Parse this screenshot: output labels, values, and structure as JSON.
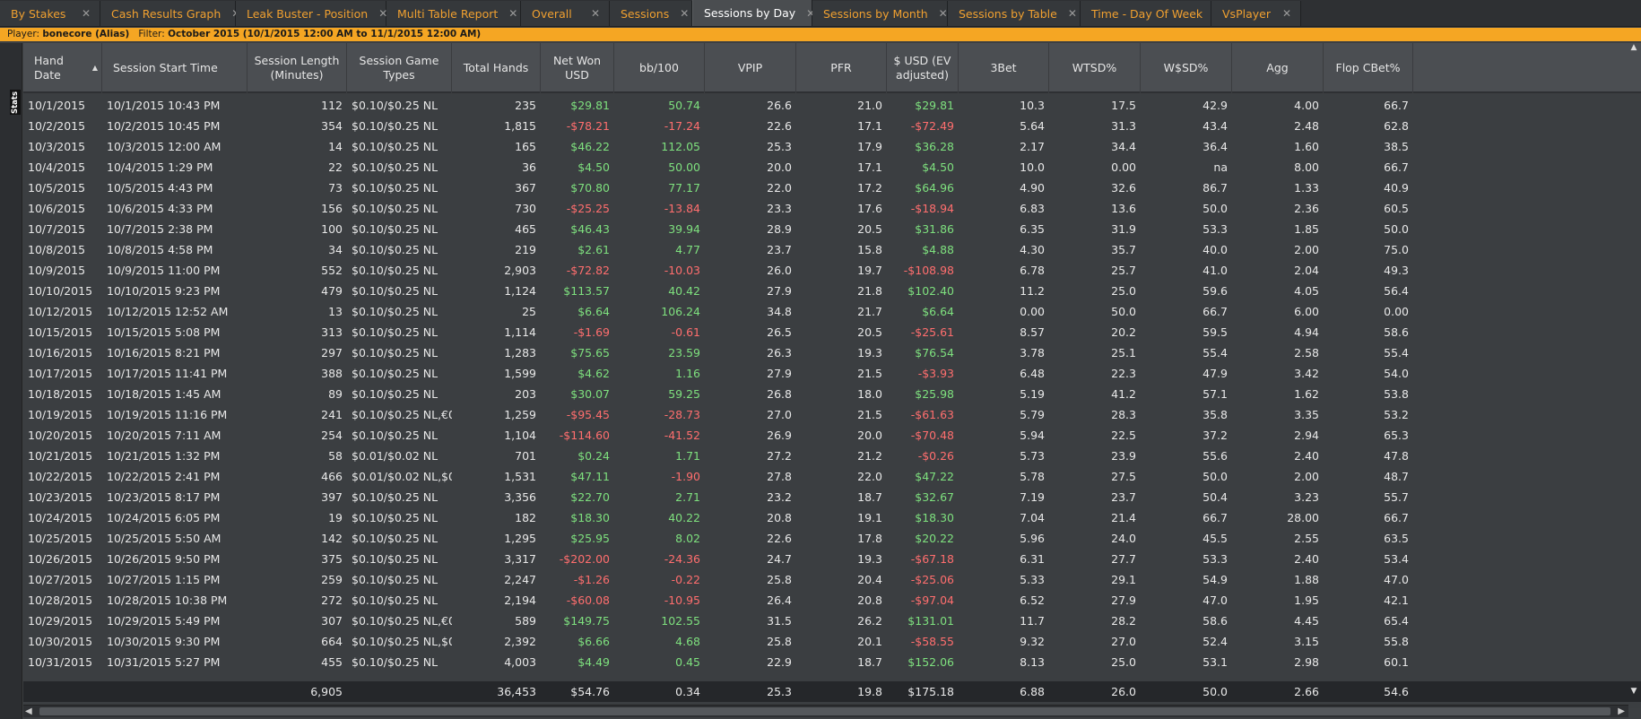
{
  "tabs": [
    {
      "label": "By Stakes",
      "width": 112,
      "active": false
    },
    {
      "label": "Cash Results Graph",
      "width": 151,
      "active": false
    },
    {
      "label": "Leak Buster - Position",
      "width": 168,
      "active": false
    },
    {
      "label": "Multi Table Report",
      "width": 150,
      "active": false
    },
    {
      "label": "Overall",
      "width": 99,
      "active": false
    },
    {
      "label": "Sessions",
      "width": 92,
      "active": false
    },
    {
      "label": "Sessions by Day",
      "width": 134,
      "active": true
    },
    {
      "label": "Sessions by Month",
      "width": 151,
      "active": false
    },
    {
      "label": "Sessions by Table",
      "width": 148,
      "active": false
    },
    {
      "label": "Time - Day Of Week",
      "width": 146,
      "active": false
    },
    {
      "label": "VsPlayer",
      "width": 100,
      "active": false
    }
  ],
  "tab_close_glyph": "✕",
  "filter": {
    "player_label": "Player:",
    "player": "bonecore (Alias)",
    "filter_label": "Filter:",
    "filter": "October 2015 (10/1/2015 12:00 AM to 11/1/2015 12:00 AM)"
  },
  "stats_button": "Stats",
  "sort_indicator": "▲",
  "columns": [
    {
      "label": "Hand Date",
      "align": "l",
      "sorted": true
    },
    {
      "label": "Session Start Time",
      "align": "l"
    },
    {
      "label": "Session Length (Minutes)",
      "align": "r"
    },
    {
      "label": "Session Game Types",
      "align": "l"
    },
    {
      "label": "Total Hands",
      "align": "r"
    },
    {
      "label": "Net Won USD",
      "align": "r",
      "colored": true
    },
    {
      "label": "bb/100",
      "align": "r",
      "colored": true
    },
    {
      "label": "VPIP",
      "align": "r"
    },
    {
      "label": "PFR",
      "align": "r"
    },
    {
      "label": "$ USD (EV adjusted)",
      "align": "r",
      "colored": true
    },
    {
      "label": "3Bet",
      "align": "r"
    },
    {
      "label": "WTSD%",
      "align": "r"
    },
    {
      "label": "W$SD%",
      "align": "r"
    },
    {
      "label": "Agg",
      "align": "r"
    },
    {
      "label": "Flop CBet%",
      "align": "r"
    }
  ],
  "rows": [
    [
      "10/1/2015",
      "10/1/2015 10:43 PM",
      "112",
      "$0.10/$0.25 NL",
      "235",
      "$29.81",
      "50.74",
      "26.6",
      "21.0",
      "$29.81",
      "10.3",
      "17.5",
      "42.9",
      "4.00",
      "66.7"
    ],
    [
      "10/2/2015",
      "10/2/2015 10:45 PM",
      "354",
      "$0.10/$0.25 NL",
      "1,815",
      "-$78.21",
      "-17.24",
      "22.6",
      "17.1",
      "-$72.49",
      "5.64",
      "31.3",
      "43.4",
      "2.48",
      "62.8"
    ],
    [
      "10/3/2015",
      "10/3/2015 12:00 AM",
      "14",
      "$0.10/$0.25 NL",
      "165",
      "$46.22",
      "112.05",
      "25.3",
      "17.9",
      "$36.28",
      "2.17",
      "34.4",
      "36.4",
      "1.60",
      "38.5"
    ],
    [
      "10/4/2015",
      "10/4/2015 1:29 PM",
      "22",
      "$0.10/$0.25 NL",
      "36",
      "$4.50",
      "50.00",
      "20.0",
      "17.1",
      "$4.50",
      "10.0",
      "0.00",
      "na",
      "8.00",
      "66.7"
    ],
    [
      "10/5/2015",
      "10/5/2015 4:43 PM",
      "73",
      "$0.10/$0.25 NL",
      "367",
      "$70.80",
      "77.17",
      "22.0",
      "17.2",
      "$64.96",
      "4.90",
      "32.6",
      "86.7",
      "1.33",
      "40.9"
    ],
    [
      "10/6/2015",
      "10/6/2015 4:33 PM",
      "156",
      "$0.10/$0.25 NL",
      "730",
      "-$25.25",
      "-13.84",
      "23.3",
      "17.6",
      "-$18.94",
      "6.83",
      "13.6",
      "50.0",
      "2.36",
      "60.5"
    ],
    [
      "10/7/2015",
      "10/7/2015 2:38 PM",
      "100",
      "$0.10/$0.25 NL",
      "465",
      "$46.43",
      "39.94",
      "28.9",
      "20.5",
      "$31.86",
      "6.35",
      "31.9",
      "53.3",
      "1.85",
      "50.0"
    ],
    [
      "10/8/2015",
      "10/8/2015 4:58 PM",
      "34",
      "$0.10/$0.25 NL",
      "219",
      "$2.61",
      "4.77",
      "23.7",
      "15.8",
      "$4.88",
      "4.30",
      "35.7",
      "40.0",
      "2.00",
      "75.0"
    ],
    [
      "10/9/2015",
      "10/9/2015 11:00 PM",
      "552",
      "$0.10/$0.25 NL",
      "2,903",
      "-$72.82",
      "-10.03",
      "26.0",
      "19.7",
      "-$108.98",
      "6.78",
      "25.7",
      "41.0",
      "2.04",
      "49.3"
    ],
    [
      "10/10/2015",
      "10/10/2015 9:23 PM",
      "479",
      "$0.10/$0.25 NL",
      "1,124",
      "$113.57",
      "40.42",
      "27.9",
      "21.8",
      "$102.40",
      "11.2",
      "25.0",
      "59.6",
      "4.05",
      "56.4"
    ],
    [
      "10/12/2015",
      "10/12/2015 12:52 AM",
      "13",
      "$0.10/$0.25 NL",
      "25",
      "$6.64",
      "106.24",
      "34.8",
      "21.7",
      "$6.64",
      "0.00",
      "50.0",
      "66.7",
      "6.00",
      "0.00"
    ],
    [
      "10/15/2015",
      "10/15/2015 5:08 PM",
      "313",
      "$0.10/$0.25 NL",
      "1,114",
      "-$1.69",
      "-0.61",
      "26.5",
      "20.5",
      "-$25.61",
      "8.57",
      "20.2",
      "59.5",
      "4.94",
      "58.6"
    ],
    [
      "10/16/2015",
      "10/16/2015 8:21 PM",
      "297",
      "$0.10/$0.25 NL",
      "1,283",
      "$75.65",
      "23.59",
      "26.3",
      "19.3",
      "$76.54",
      "3.78",
      "25.1",
      "55.4",
      "2.58",
      "55.4"
    ],
    [
      "10/17/2015",
      "10/17/2015 11:41 PM",
      "388",
      "$0.10/$0.25 NL",
      "1,599",
      "$4.62",
      "1.16",
      "27.9",
      "21.5",
      "-$3.93",
      "6.48",
      "22.3",
      "47.9",
      "3.42",
      "54.0"
    ],
    [
      "10/18/2015",
      "10/18/2015 1:45 AM",
      "89",
      "$0.10/$0.25 NL",
      "203",
      "$30.07",
      "59.25",
      "26.8",
      "18.0",
      "$25.98",
      "5.19",
      "41.2",
      "57.1",
      "1.62",
      "53.8"
    ],
    [
      "10/19/2015",
      "10/19/2015 11:16 PM",
      "241",
      "$0.10/$0.25 NL,€0.01/€",
      "1,259",
      "-$95.45",
      "-28.73",
      "27.0",
      "21.5",
      "-$61.63",
      "5.79",
      "28.3",
      "35.8",
      "3.35",
      "53.2"
    ],
    [
      "10/20/2015",
      "10/20/2015 7:11 AM",
      "254",
      "$0.10/$0.25 NL",
      "1,104",
      "-$114.60",
      "-41.52",
      "26.9",
      "20.0",
      "-$70.48",
      "5.94",
      "22.5",
      "37.2",
      "2.94",
      "65.3"
    ],
    [
      "10/21/2015",
      "10/21/2015 1:32 PM",
      "58",
      "$0.01/$0.02 NL",
      "701",
      "$0.24",
      "1.71",
      "27.2",
      "21.2",
      "-$0.26",
      "5.73",
      "23.9",
      "55.6",
      "2.40",
      "47.8"
    ],
    [
      "10/22/2015",
      "10/22/2015 2:41 PM",
      "466",
      "$0.01/$0.02 NL,$0.10/$",
      "1,531",
      "$47.11",
      "-1.90",
      "27.8",
      "22.0",
      "$47.22",
      "5.78",
      "27.5",
      "50.0",
      "2.00",
      "48.7"
    ],
    [
      "10/23/2015",
      "10/23/2015 8:17 PM",
      "397",
      "$0.10/$0.25 NL",
      "3,356",
      "$22.70",
      "2.71",
      "23.2",
      "18.7",
      "$32.67",
      "7.19",
      "23.7",
      "50.4",
      "3.23",
      "55.7"
    ],
    [
      "10/24/2015",
      "10/24/2015 6:05 PM",
      "19",
      "$0.10/$0.25 NL",
      "182",
      "$18.30",
      "40.22",
      "20.8",
      "19.1",
      "$18.30",
      "7.04",
      "21.4",
      "66.7",
      "28.00",
      "66.7"
    ],
    [
      "10/25/2015",
      "10/25/2015 5:50 AM",
      "142",
      "$0.10/$0.25 NL",
      "1,295",
      "$25.95",
      "8.02",
      "22.6",
      "17.8",
      "$20.22",
      "5.96",
      "24.0",
      "45.5",
      "2.55",
      "63.5"
    ],
    [
      "10/26/2015",
      "10/26/2015 9:50 PM",
      "375",
      "$0.10/$0.25 NL",
      "3,317",
      "-$202.00",
      "-24.36",
      "24.7",
      "19.3",
      "-$67.18",
      "6.31",
      "27.7",
      "53.3",
      "2.40",
      "53.4"
    ],
    [
      "10/27/2015",
      "10/27/2015 1:15 PM",
      "259",
      "$0.10/$0.25 NL",
      "2,247",
      "-$1.26",
      "-0.22",
      "25.8",
      "20.4",
      "-$25.06",
      "5.33",
      "29.1",
      "54.9",
      "1.88",
      "47.0"
    ],
    [
      "10/28/2015",
      "10/28/2015 10:38 PM",
      "272",
      "$0.10/$0.25 NL",
      "2,194",
      "-$60.08",
      "-10.95",
      "26.4",
      "20.8",
      "-$97.04",
      "6.52",
      "27.9",
      "47.0",
      "1.95",
      "42.1"
    ],
    [
      "10/29/2015",
      "10/29/2015 5:49 PM",
      "307",
      "$0.10/$0.25 NL,€0.01/€",
      "589",
      "$149.75",
      "102.55",
      "31.5",
      "26.2",
      "$131.01",
      "11.7",
      "28.2",
      "58.6",
      "4.45",
      "65.4"
    ],
    [
      "10/30/2015",
      "10/30/2015 9:30 PM",
      "664",
      "$0.10/$0.25 NL,$0.25/$",
      "2,392",
      "$6.66",
      "4.68",
      "25.8",
      "20.1",
      "-$58.55",
      "9.32",
      "27.0",
      "52.4",
      "3.15",
      "55.8"
    ],
    [
      "10/31/2015",
      "10/31/2015 5:27 PM",
      "455",
      "$0.10/$0.25 NL",
      "4,003",
      "$4.49",
      "0.45",
      "22.9",
      "18.7",
      "$152.06",
      "8.13",
      "25.0",
      "53.1",
      "2.98",
      "60.1"
    ]
  ],
  "totals": [
    "",
    "",
    "6,905",
    "",
    "36,453",
    "$54.76",
    "0.34",
    "25.3",
    "19.8",
    "$175.18",
    "6.88",
    "26.0",
    "50.0",
    "2.66",
    "54.6"
  ],
  "colors": {
    "accent": "#f5a623",
    "tab_text": "#f0a030",
    "positive": "#7ee07e",
    "negative": "#ff6e6e"
  }
}
